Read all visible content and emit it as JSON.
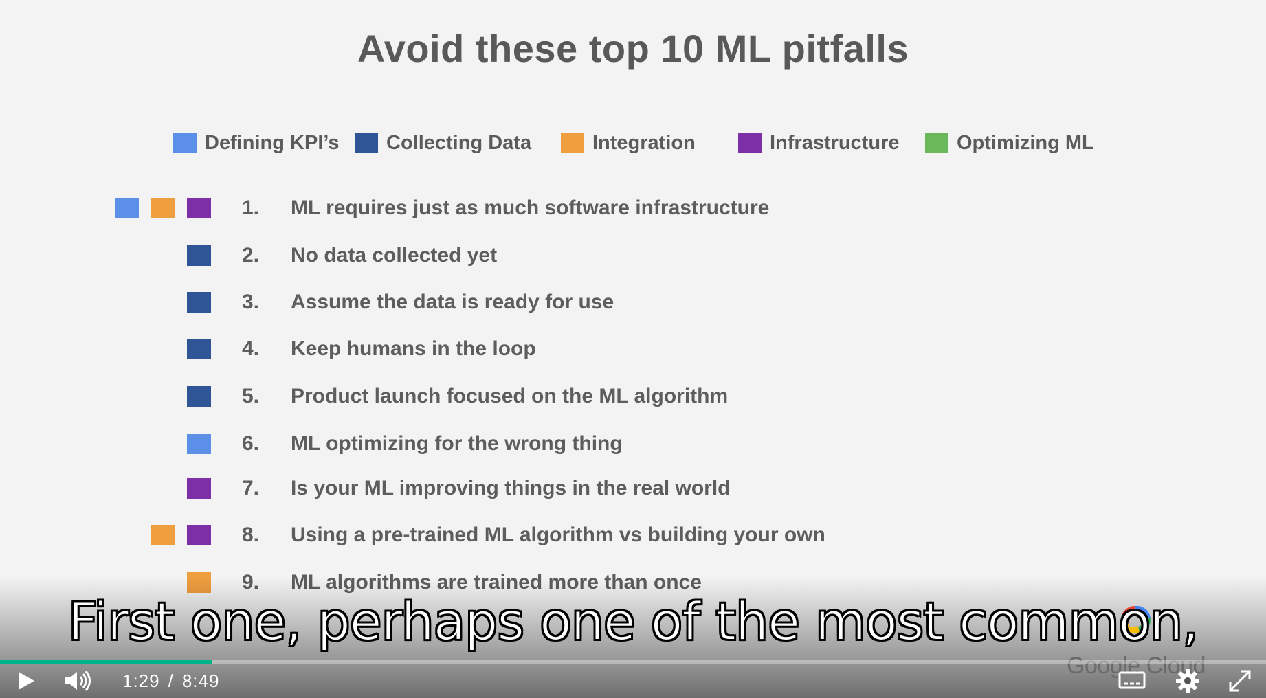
{
  "slide": {
    "title": "Avoid these top 10 ML pitfalls",
    "legend": [
      {
        "label": "Defining KPI’s",
        "color": "#5b8fe8"
      },
      {
        "label": "Collecting Data",
        "color": "#2f5597"
      },
      {
        "label": "Integration",
        "color": "#ee9d3f"
      },
      {
        "label": "Infrastructure",
        "color": "#7d2fa8"
      },
      {
        "label": "Optimizing ML",
        "color": "#6ab85a"
      }
    ],
    "items": [
      {
        "num": "1.",
        "text": "ML requires just as much software infrastructure",
        "tags": [
          "Defining KPI’s",
          "Integration",
          "Infrastructure"
        ]
      },
      {
        "num": "2.",
        "text": "No data collected yet",
        "tags": [
          "Collecting Data"
        ]
      },
      {
        "num": "3.",
        "text": "Assume the data is ready for use",
        "tags": [
          "Collecting Data"
        ]
      },
      {
        "num": "4.",
        "text": "Keep humans in the loop",
        "tags": [
          "Collecting Data"
        ]
      },
      {
        "num": "5.",
        "text": "Product launch focused on the ML algorithm",
        "tags": [
          "Collecting Data"
        ]
      },
      {
        "num": "6.",
        "text": "ML optimizing for the wrong thing",
        "tags": [
          "Defining KPI’s"
        ]
      },
      {
        "num": "7.",
        "text": "Is your ML improving things in the real world",
        "tags": [
          "Infrastructure"
        ]
      },
      {
        "num": "8.",
        "text": "Using a pre-trained ML algorithm vs building your own",
        "tags": [
          "Integration",
          "Infrastructure"
        ]
      },
      {
        "num": "9.",
        "text": "ML algorithms are trained more than once",
        "tags": [
          "Integration"
        ]
      }
    ],
    "brand": "Google Cloud"
  },
  "player": {
    "caption": "First one, perhaps one of the most common,",
    "current_time": "1:29",
    "separator": "/",
    "duration": "8:49",
    "progress_fraction": 0.168,
    "icons": {
      "play": "play-icon",
      "volume": "volume-icon",
      "captions": "captions-icon",
      "settings": "gear-icon",
      "fullscreen": "fullscreen-icon"
    }
  }
}
